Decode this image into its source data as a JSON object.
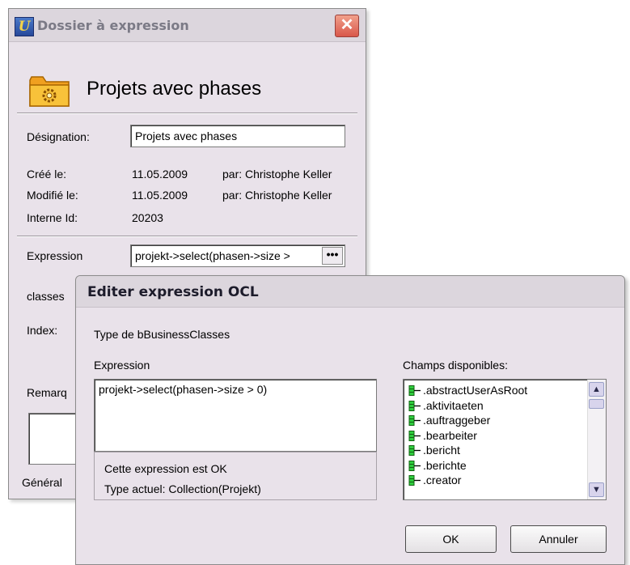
{
  "background_window": {
    "title": "Dossier à expression",
    "header_title": "Projets avec phases",
    "designation_label": "Désignation:",
    "designation_value": "Projets avec phases",
    "created_label": "Créé le:",
    "created_date": "11.05.2009",
    "created_by": "par: Christophe Keller",
    "modified_label": "Modifié le:",
    "modified_date": "11.05.2009",
    "modified_by": "par: Christophe Keller",
    "internal_id_label": "Interne Id:",
    "internal_id_value": "20203",
    "expression_label": "Expression",
    "expression_value": "projekt->select(phasen->size >",
    "ellipsis_button": "•••",
    "classes_label": "classes",
    "index_label": "Index:",
    "remark_label": "Remarq",
    "general_tab": "Général",
    "close_glyph": "✕"
  },
  "dialog": {
    "title": "Editer expression OCL",
    "type_label": "Type de bBusinessClasses",
    "expression_label": "Expression",
    "expression_text": "projekt->select(phasen->size > 0)",
    "status_ok": "Cette expression est OK",
    "status_type": "Type actuel: Collection(Projekt)",
    "fields_label": "Champs disponibles:",
    "fields": [
      ".abstractUserAsRoot",
      ".aktivitaeten",
      ".auftraggeber",
      ".bearbeiter",
      ".bericht",
      ".berichte",
      ".creator"
    ],
    "ok_button": "OK",
    "cancel_button": "Annuler"
  },
  "icons": {
    "app": "app-logo-icon",
    "folder": "folder-gear-icon",
    "field": "field-icon",
    "scroll_up": "chevron-up-icon",
    "scroll_down": "chevron-down-icon"
  },
  "colors": {
    "window_bg": "#e9e2ea",
    "titlebar_bg": "#dcd6dd",
    "close_red": "#d9574a",
    "field_icon_green": "#2fcf3f",
    "folder_orange": "#f0a020"
  }
}
